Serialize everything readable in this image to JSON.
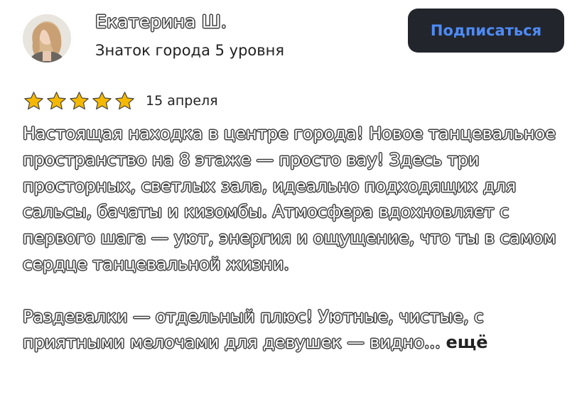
{
  "author": {
    "name": "Екатерина Ш.",
    "level": "Знаток города 5 уровня"
  },
  "subscribe_label": "Подписаться",
  "review": {
    "rating": 5,
    "max_rating": 5,
    "date": "15 апреля",
    "paragraph_1": "Настоящая находка в центре города! Новое танцевальное пространство на 8 этаже — просто вау! Здесь три просторных, светлых зала, идеально подходящих для сальсы, бачаты и кизомбы. Атмосфера вдохновляет с первого шага — уют, энергия и ощущение, что ты в самом сердце танцевальной жизни.",
    "paragraph_2": "Раздевалки — отдельный плюс! Уютные, чистые, с приятными мелочами для девушек — видно...",
    "more_label": "ещё"
  },
  "colors": {
    "button_bg": "#22252b",
    "button_text": "#4e8bf5",
    "star": "#f5b800",
    "outline": "#3f3f3f"
  },
  "icons": {
    "star": "star-icon",
    "avatar": "avatar"
  }
}
